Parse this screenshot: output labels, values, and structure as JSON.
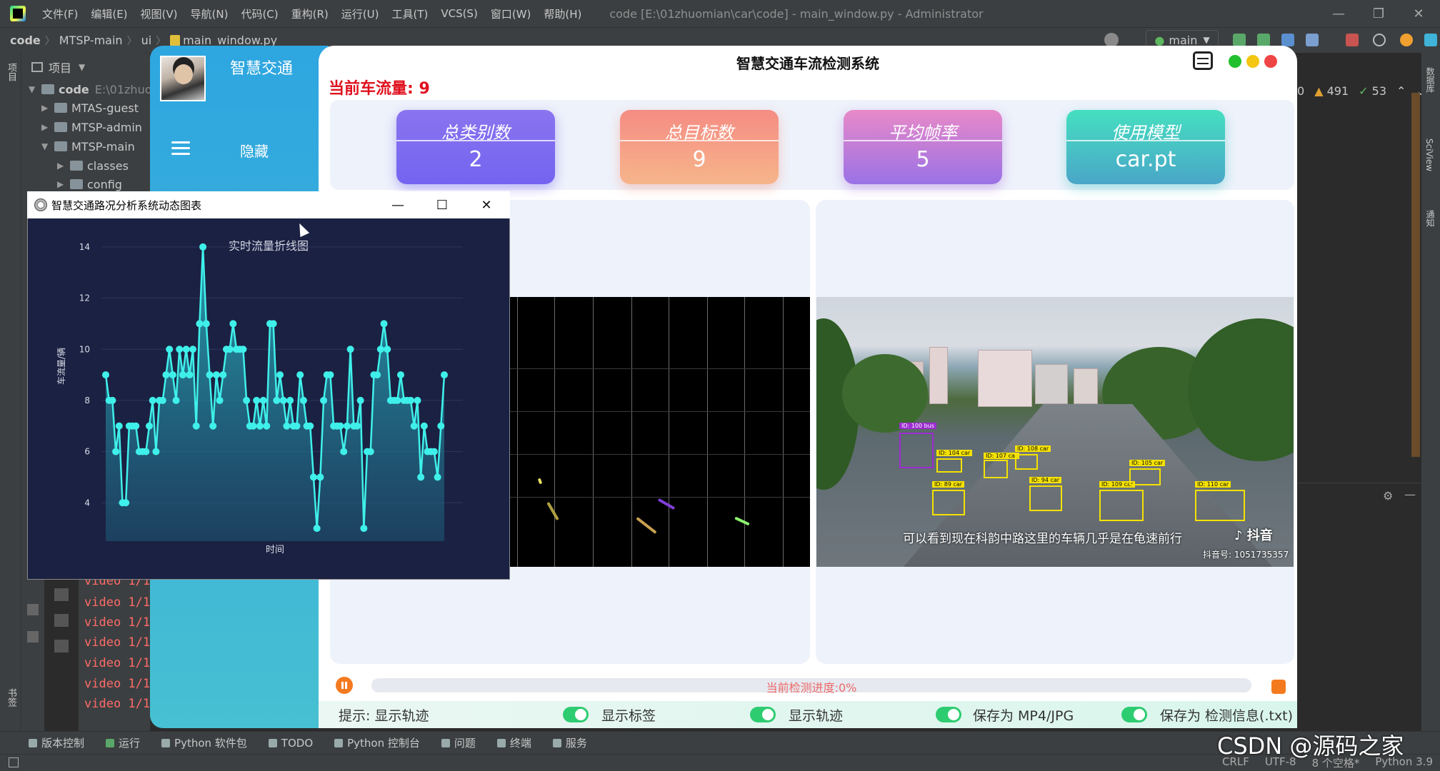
{
  "ide": {
    "menu": [
      "文件(F)",
      "编辑(E)",
      "视图(V)",
      "导航(N)",
      "代码(C)",
      "重构(R)",
      "运行(U)",
      "工具(T)",
      "VCS(S)",
      "窗口(W)",
      "帮助(H)"
    ],
    "window_title": "code [E:\\01zhuomian\\car\\code] - main_window.py - Administrator",
    "breadcrumb": [
      "code",
      "MTSP-main",
      "ui",
      "main_window.py"
    ],
    "branch": "main",
    "project_label": "项目",
    "tree": [
      {
        "label": "code",
        "extra": "E:\\01zhuo"
      },
      {
        "label": "MTAS-guest"
      },
      {
        "label": "MTSP-admin"
      },
      {
        "label": "MTSP-main"
      },
      {
        "label": "classes"
      },
      {
        "label": "config"
      }
    ],
    "inspections": {
      "count_a": "0",
      "warnings": "491",
      "weak": "53"
    },
    "console_lines": [
      "video 1/1",
      "video 1/1",
      "video 1/1",
      "video 1/1",
      "video 1/1",
      "video 1/1",
      "video 1/1"
    ],
    "bottom_tabs": [
      "版本控制",
      "运行",
      "Python 软件包",
      "TODO",
      "Python 控制台",
      "问题",
      "终端",
      "服务"
    ],
    "status": {
      "line_sep": "CRLF",
      "encoding": "UTF-8",
      "indent": "8 个空格*",
      "interpreter": "Python 3.9"
    },
    "watermark": "CSDN @源码之家",
    "left_stripe_labels": [
      "项目",
      "书签",
      "结构"
    ],
    "right_stripe_labels": [
      "数据库",
      "SciView",
      "通知"
    ]
  },
  "app": {
    "sidebar_title": "智慧交通",
    "hide_label": "隐藏",
    "title": "智慧交通车流检测系统",
    "flow_label": "当前车流量: 9",
    "cards": [
      {
        "title": "总类别数",
        "value": "2"
      },
      {
        "title": "总目标数",
        "value": "9"
      },
      {
        "title": "平均帧率",
        "value": "5"
      },
      {
        "title": "使用模型",
        "value": "car.pt"
      }
    ],
    "video_caption": "可以看到现在科韵中路这里的车辆几乎是在龟速前行",
    "douyin_logo": "抖音",
    "douyin_id": "抖音号: 1051735357",
    "video_tags": [
      "ID: 100 bus",
      "ID: 104 car",
      "ID: 107 car",
      "ID: 108 car",
      "ID: 89 car",
      "ID: 94 car",
      "ID: 109 car",
      "ID: 105 car",
      "ID: 110 car"
    ],
    "progress": {
      "label": "当前检测进度:0%",
      "fraction": 0.0
    },
    "hint": "提示: 显示轨迹",
    "options": [
      "显示标签",
      "显示轨迹",
      "保存为 MP4/JPG",
      "保存为 检测信息(.txt)"
    ],
    "colors": {
      "sidebar": "#2ea6e0",
      "flow": "#e0101e",
      "toggle_on": "#2ecc71",
      "accent_orange": "#f47a20"
    }
  },
  "chart_window": {
    "title": "智慧交通路况分析系统动态图表"
  },
  "chart_data": {
    "type": "area",
    "title": "实时流量折线图",
    "xlabel": "时间",
    "ylabel": "车流量/辆",
    "yticks": [
      4,
      6,
      8,
      10,
      12,
      14
    ],
    "ylim": [
      2.5,
      14.5
    ],
    "grid": true,
    "series": [
      {
        "values": [
          9,
          8,
          8,
          6,
          7,
          4,
          4,
          7,
          7,
          7,
          6,
          6,
          6,
          7,
          8,
          6,
          8,
          8,
          9,
          10,
          9,
          8,
          10,
          9,
          10,
          9,
          10,
          7,
          11,
          14,
          11,
          9,
          7,
          9,
          8,
          9,
          10,
          10,
          11,
          10,
          10,
          10,
          8,
          7,
          7,
          8,
          7,
          8,
          7,
          11,
          11,
          8,
          9,
          8,
          7,
          8,
          7,
          7,
          9,
          8,
          7,
          7,
          5,
          3,
          5,
          8,
          9,
          9,
          7,
          7,
          7,
          6,
          7,
          10,
          7,
          7,
          8,
          3,
          6,
          6,
          9,
          9,
          10,
          11,
          10,
          8,
          8,
          8,
          9,
          8,
          8,
          8,
          7,
          8,
          5,
          7,
          6,
          6,
          6,
          5,
          7,
          9
        ]
      }
    ]
  }
}
